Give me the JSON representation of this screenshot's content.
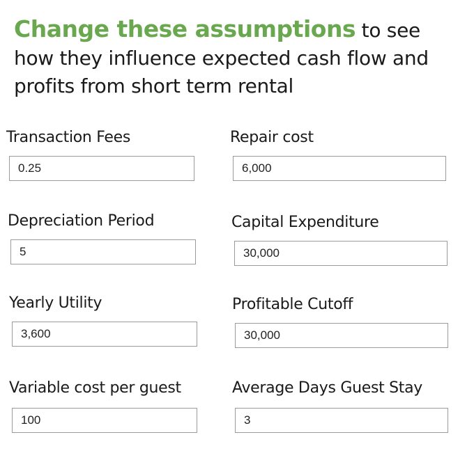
{
  "header": {
    "accent": "Change these assumptions",
    "rest": " to see how they influence expected cash flow and profits from short term rental"
  },
  "fields": [
    {
      "label": "Transaction Fees",
      "value": "0.25"
    },
    {
      "label": "Repair cost",
      "value": "6,000"
    },
    {
      "label": "Depreciation Period",
      "value": "5"
    },
    {
      "label": "Capital Expenditure",
      "value": "30,000"
    },
    {
      "label": "Yearly Utility",
      "value": "3,600"
    },
    {
      "label": "Profitable Cutoff",
      "value": "30,000"
    },
    {
      "label": "Variable cost per guest",
      "value": "100"
    },
    {
      "label": "Average Days Guest Stay",
      "value": "3"
    }
  ],
  "colors": {
    "accent": "#6aa84f",
    "text": "#1a1a1a",
    "input_border": "#9a9a9a"
  }
}
